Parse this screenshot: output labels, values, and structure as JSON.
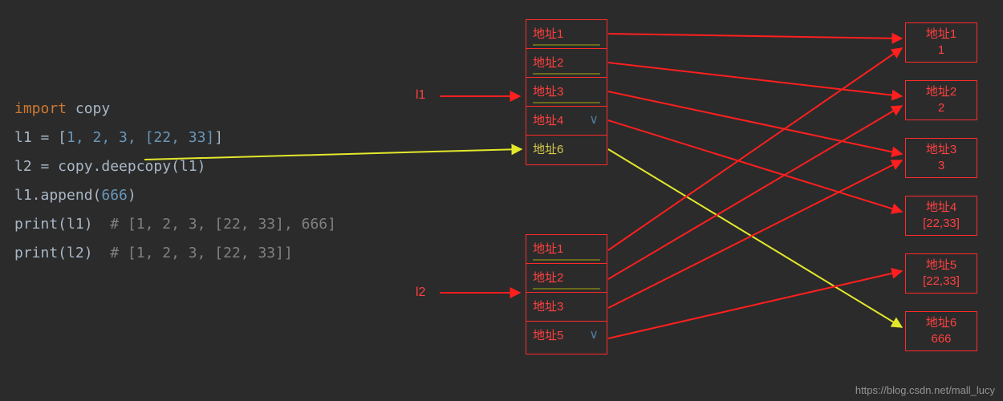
{
  "code": {
    "line1_import": "import",
    "line1_copy": " copy",
    "line2_pre": "l1 = [",
    "line2_nums": "1, 2, 3, [22, 33]",
    "line2_post": "]",
    "line3": "l2 = copy.deepcopy(l1)",
    "line4_pre": "l1.append(",
    "line4_num": "666",
    "line4_post": ")",
    "line5_code": "print(l1)",
    "line5_comment": "  # [1, 2, 3, [22, 33], 666]",
    "line6_code": "print(l2)",
    "line6_comment": "  # [1, 2, 3, [22, 33]]"
  },
  "labels": {
    "l1": "l1",
    "l2": "l2"
  },
  "column_top": {
    "cells": [
      "地址1",
      "地址2",
      "地址3",
      "地址4",
      "地址6"
    ]
  },
  "column_bottom": {
    "cells": [
      "地址1",
      "地址2",
      "地址3",
      "地址5"
    ]
  },
  "right_boxes": [
    {
      "title": "地址1",
      "value": "1"
    },
    {
      "title": "地址2",
      "value": "2"
    },
    {
      "title": "地址3",
      "value": "3"
    },
    {
      "title": "地址4",
      "value": "[22,33]"
    },
    {
      "title": "地址5",
      "value": "[22,33]"
    },
    {
      "title": "地址6",
      "value": "666"
    }
  ],
  "watermark": "https://blog.csdn.net/mall_lucy",
  "colors": {
    "bg": "#2b2b2b",
    "red": "#ff2a2a",
    "yellow": "#d6c94b",
    "arrow_red": "#ff1f1f",
    "arrow_yellow": "#e3e82b"
  }
}
